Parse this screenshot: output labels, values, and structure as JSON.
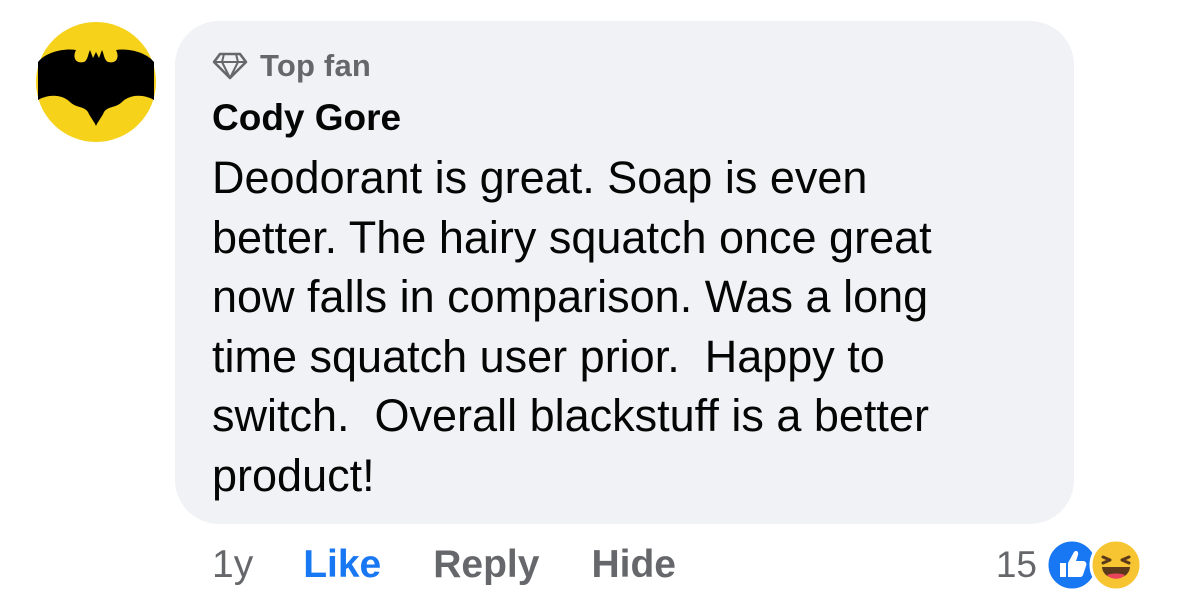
{
  "comment": {
    "badge": "Top fan",
    "badge_icon": "diamond-icon",
    "author": "Cody Gore",
    "avatar": "batman-logo",
    "text_lines": [
      "Deodorant is great. Soap is even",
      "better. The hairy squatch once great",
      "now falls in comparison. Was a long",
      "time squatch user prior.  Happy to",
      "switch.  Overall blackstuff is a better",
      "product!"
    ]
  },
  "actions": {
    "age": "1y",
    "like": "Like",
    "reply": "Reply",
    "hide": "Hide"
  },
  "reactions": {
    "count": "15",
    "types": [
      "like-icon",
      "haha-icon"
    ]
  },
  "colors": {
    "bubble": "#f0f2f5",
    "like_blue": "#1877f2",
    "secondary_text": "#65676b",
    "avatar_yellow": "#f7d21b"
  }
}
